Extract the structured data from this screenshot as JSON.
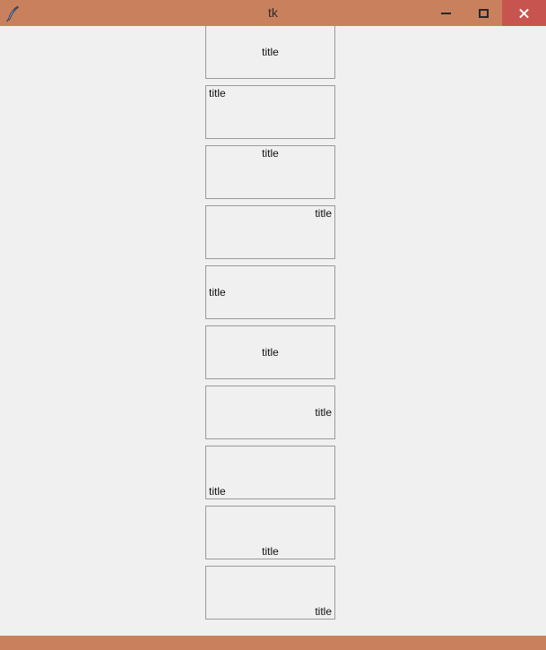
{
  "window": {
    "title": "tk",
    "icon": "tk-feather-icon",
    "titlebar_color": "#c9805d",
    "close_button_color": "#c8544f",
    "client_background": "#f0f0f0",
    "frame_border_color": "#9a9a9a"
  },
  "titlebar": {
    "minimize_label": "Minimize",
    "maximize_label": "Maximize",
    "close_label": "Close"
  },
  "frames": [
    {
      "title": "title",
      "anchor": "n",
      "valign": "a-middle",
      "halign": "j-center"
    },
    {
      "title": "title",
      "anchor": "nw",
      "valign": "a-top",
      "halign": "j-start"
    },
    {
      "title": "title",
      "anchor": "n",
      "valign": "a-top",
      "halign": "j-center"
    },
    {
      "title": "title",
      "anchor": "ne",
      "valign": "a-top",
      "halign": "j-end"
    },
    {
      "title": "title",
      "anchor": "w",
      "valign": "a-middle",
      "halign": "j-start"
    },
    {
      "title": "title",
      "anchor": "center",
      "valign": "a-middle",
      "halign": "j-center"
    },
    {
      "title": "title",
      "anchor": "e",
      "valign": "a-middle",
      "halign": "j-end"
    },
    {
      "title": "title",
      "anchor": "sw",
      "valign": "a-bottom",
      "halign": "j-start"
    },
    {
      "title": "title",
      "anchor": "s",
      "valign": "a-bottom",
      "halign": "j-center"
    },
    {
      "title": "title",
      "anchor": "se",
      "valign": "a-bottom",
      "halign": "j-end"
    }
  ]
}
